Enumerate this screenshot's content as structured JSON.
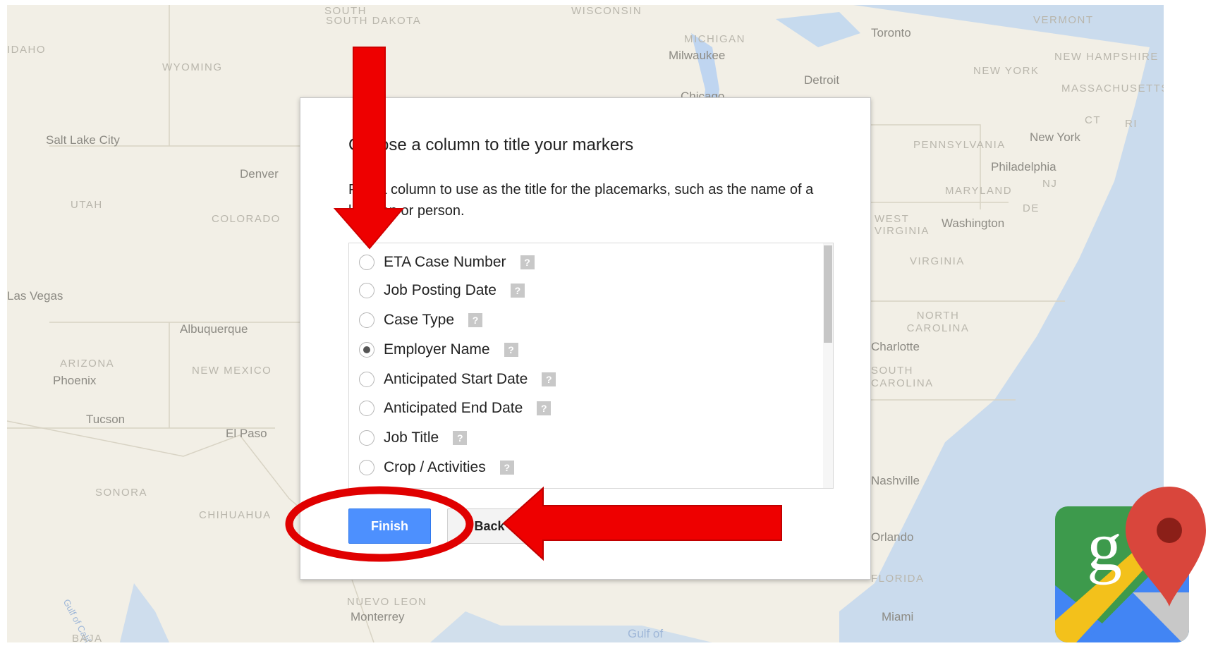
{
  "map": {
    "state_labels": [
      "SOUTH DAKOTA",
      "WISCONSIN",
      "MICHIGAN",
      "VERMONT",
      "NEW HAMPSHIRE",
      "MASSACHUSETTS",
      "NEW YORK",
      "PENNSYLVANIA",
      "WYOMING",
      "UTAH",
      "COLORADO",
      "MARYLAND",
      "DE",
      "NJ",
      "CT",
      "RI",
      "VIRGINIA",
      "WEST VIRGINIA",
      "NORTH CAROLINA",
      "SOUTH CAROLINA",
      "ARIZONA",
      "NEW MEXICO",
      "SONORA",
      "CHIHUAHUA",
      "NUEVO LEON",
      "FLORIDA",
      "IDAHO"
    ],
    "city_labels": [
      "Toronto",
      "Milwaukee",
      "Detroit",
      "Chicago",
      "Salt Lake City",
      "Denver",
      "New York",
      "Philadelphia",
      "Washington",
      "Albuquerque",
      "Phoenix",
      "Tucson",
      "El Paso",
      "Charlotte",
      "Monterrey",
      "Miami",
      "Gulf of",
      "Gulf of California",
      "Las Vegas",
      "Nashville",
      "Orlando",
      "BAJA"
    ]
  },
  "dialog": {
    "title": "Choose a column to title your markers",
    "description": "Pick a column to use as the title for the placemarks, such as the name of a location or person.",
    "options": [
      {
        "label": "ETA Case Number",
        "checked": false
      },
      {
        "label": "Job Posting Date",
        "checked": false
      },
      {
        "label": "Case Type",
        "checked": false
      },
      {
        "label": "Employer Name",
        "checked": true
      },
      {
        "label": "Anticipated Start Date",
        "checked": false
      },
      {
        "label": "Anticipated End Date",
        "checked": false
      },
      {
        "label": "Job Title",
        "checked": false
      },
      {
        "label": "Crop / Activities",
        "checked": false
      }
    ],
    "help_glyph": "?",
    "finish_label": "Finish",
    "back_label": "Back"
  },
  "annotations": {
    "arrow_color": "#ee0000",
    "circle_color": "#ee0000"
  },
  "logo": {
    "letter": "g",
    "icon": "google-maps-logo-icon"
  }
}
